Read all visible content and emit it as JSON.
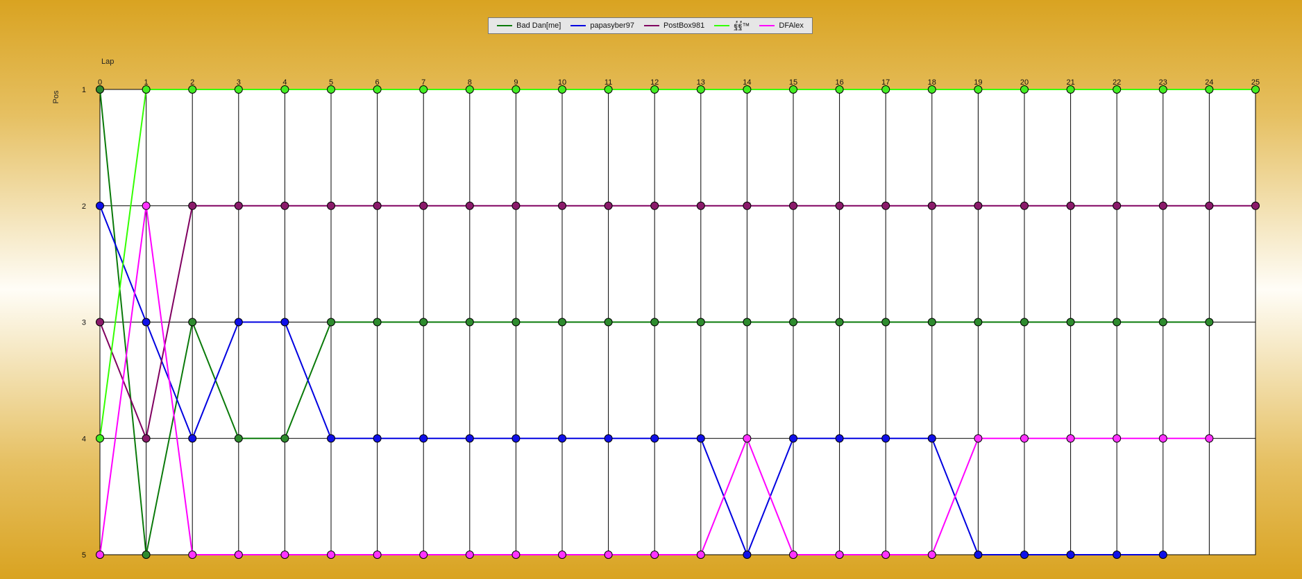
{
  "chart_data": {
    "type": "line",
    "title": "",
    "xlabel": "Lap",
    "ylabel": "Pos",
    "x": [
      0,
      1,
      2,
      3,
      4,
      5,
      6,
      7,
      8,
      9,
      10,
      11,
      12,
      13,
      14,
      15,
      16,
      17,
      18,
      19,
      20,
      21,
      22,
      23,
      24,
      25
    ],
    "y_ticks": [
      1,
      2,
      3,
      4,
      5
    ],
    "ylim": [
      1,
      5
    ],
    "xlim": [
      0,
      25
    ],
    "y_inverted": true,
    "grid": true,
    "legend_position": "top-center",
    "series": [
      {
        "name": "Bad Dan[me]",
        "color": "#0a7a0a",
        "marker_color": "#2e8b2e",
        "values": [
          1,
          5,
          3,
          4,
          4,
          3,
          3,
          3,
          3,
          3,
          3,
          3,
          3,
          3,
          3,
          3,
          3,
          3,
          3,
          3,
          3,
          3,
          3,
          3,
          3
        ]
      },
      {
        "name": "papasyber97",
        "color": "#0000e0",
        "marker_color": "#1010e8",
        "values": [
          2,
          3,
          4,
          3,
          3,
          4,
          4,
          4,
          4,
          4,
          4,
          4,
          4,
          4,
          5,
          4,
          4,
          4,
          4,
          5,
          5,
          5,
          5,
          5
        ]
      },
      {
        "name": "PostBox981",
        "color": "#800060",
        "marker_color": "#8a1a6a",
        "values": [
          3,
          4,
          2,
          2,
          2,
          2,
          2,
          2,
          2,
          2,
          2,
          2,
          2,
          2,
          2,
          2,
          2,
          2,
          2,
          2,
          2,
          2,
          2,
          2,
          2,
          2
        ]
      },
      {
        "name": "ฐ๎ฐ๎™",
        "color": "#33ff00",
        "marker_color": "#44ee22",
        "values": [
          4,
          1,
          1,
          1,
          1,
          1,
          1,
          1,
          1,
          1,
          1,
          1,
          1,
          1,
          1,
          1,
          1,
          1,
          1,
          1,
          1,
          1,
          1,
          1,
          1,
          1
        ]
      },
      {
        "name": "DFAlex",
        "color": "#ff00ff",
        "marker_color": "#ff33ff",
        "values": [
          5,
          2,
          5,
          5,
          5,
          5,
          5,
          5,
          5,
          5,
          5,
          5,
          5,
          5,
          4,
          5,
          5,
          5,
          5,
          4,
          4,
          4,
          4,
          4,
          4
        ]
      }
    ]
  }
}
